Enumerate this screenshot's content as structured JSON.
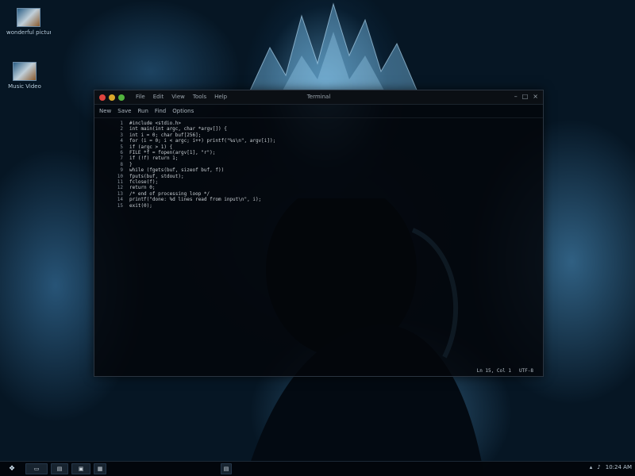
{
  "desktop": {
    "icons": [
      {
        "label": "wonderful picture"
      },
      {
        "label": "Music Video"
      }
    ]
  },
  "window": {
    "title": "Terminal",
    "menu": [
      "File",
      "Edit",
      "View",
      "Tools",
      "Help"
    ],
    "toolbar": [
      "New",
      "Save",
      "Run",
      "Find",
      "Options"
    ],
    "controls": {
      "minimize": "–",
      "maximize": "□",
      "close": "×"
    },
    "code_lines": [
      {
        "n": "1",
        "t": "#include <stdio.h>"
      },
      {
        "n": "2",
        "t": "int main(int argc, char *argv[]) {"
      },
      {
        "n": "3",
        "t": "  int i = 0; char buf[256];"
      },
      {
        "n": "4",
        "t": "  for (i = 0; i < argc; i++) printf(\"%s\\n\", argv[i]);"
      },
      {
        "n": "5",
        "t": "  if (argc > 1) {"
      },
      {
        "n": "6",
        "t": "    FILE *f = fopen(argv[1], \"r\");"
      },
      {
        "n": "7",
        "t": "    if (!f) return 1;"
      },
      {
        "n": "8",
        "t": "  }"
      },
      {
        "n": "9",
        "t": "  while (fgets(buf, sizeof buf, f))"
      },
      {
        "n": "10",
        "t": "    fputs(buf, stdout);"
      },
      {
        "n": "11",
        "t": "  fclose(f);"
      },
      {
        "n": "12",
        "t": "  return 0;"
      },
      {
        "n": "13",
        "t": "    /* end of processing loop */"
      },
      {
        "n": "14",
        "t": "      printf(\"done: %d lines read from input\\n\", i);"
      },
      {
        "n": "15",
        "t": "      exit(0);"
      }
    ],
    "status": {
      "position": "Ln 15, Col 1",
      "mode": "UTF-8"
    }
  },
  "taskbar": {
    "start_label": "❖",
    "buttons": [
      {
        "label": "▭"
      },
      {
        "label": "▤"
      },
      {
        "label": "▣"
      },
      {
        "label": "▦"
      },
      {
        "label": "▤"
      }
    ],
    "tray": {
      "time": "10:24 AM"
    }
  }
}
